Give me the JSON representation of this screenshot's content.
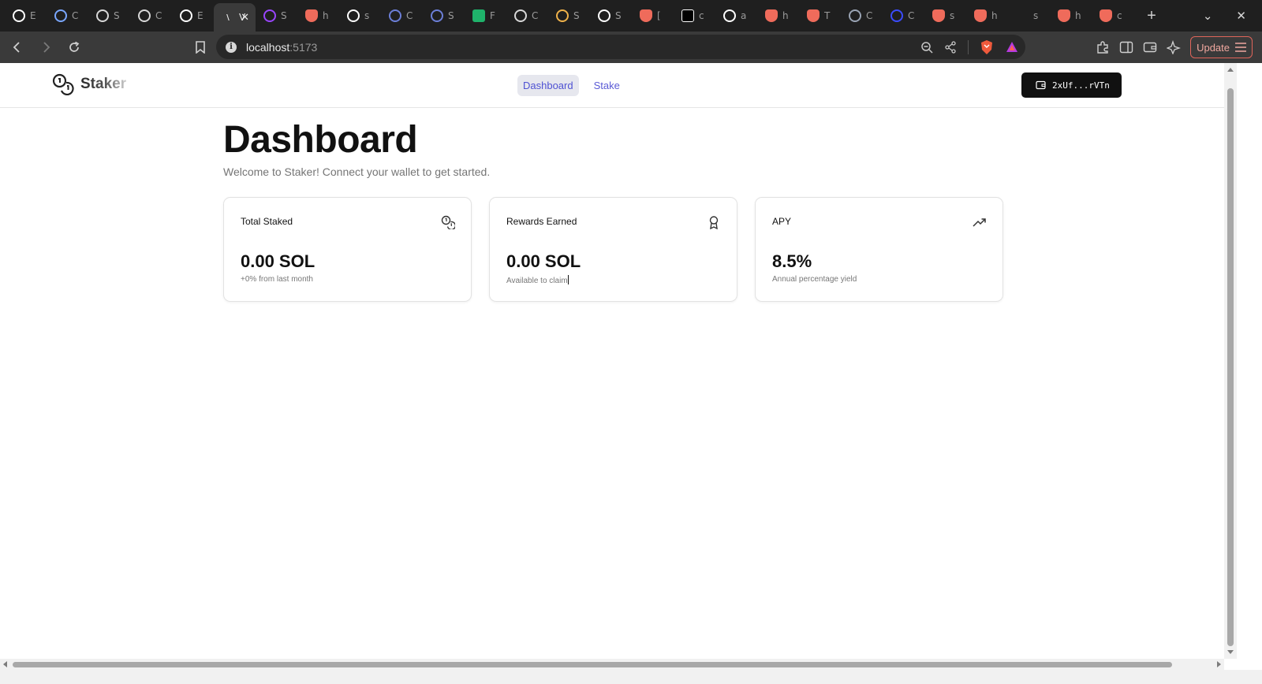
{
  "browser": {
    "tabs": [
      {
        "title": "E",
        "icon": "github-icon",
        "color": "#ffffff"
      },
      {
        "title": "C",
        "icon": "gemini-icon",
        "color": "#7aa7ff"
      },
      {
        "title": "S",
        "icon": "openai-icon",
        "color": "#d8d8d8"
      },
      {
        "title": "C",
        "icon": "globe-icon",
        "color": "#d8d8d8"
      },
      {
        "title": "E",
        "icon": "github-icon",
        "color": "#ffffff"
      },
      {
        "title": "V",
        "icon": "vite-icon",
        "color": "#e8e8e8",
        "active": true
      },
      {
        "title": "S",
        "icon": "solana-icon",
        "color": "#9945ff"
      },
      {
        "title": "h",
        "icon": "brave-icon",
        "color": "#ef6b5b"
      },
      {
        "title": "s",
        "icon": "github-icon",
        "color": "#ffffff"
      },
      {
        "title": "C",
        "icon": "chat-icon",
        "color": "#6c7fd8"
      },
      {
        "title": "S",
        "icon": "chat-icon",
        "color": "#6c7fd8"
      },
      {
        "title": "F",
        "icon": "fork-icon",
        "color": "#1fb36b"
      },
      {
        "title": "C",
        "icon": "clock-icon",
        "color": "#d8d8d8"
      },
      {
        "title": "S",
        "icon": "moon-icon",
        "color": "#f0b24a"
      },
      {
        "title": "S",
        "icon": "pill-icon",
        "color": "#ffffff"
      },
      {
        "title": "[",
        "icon": "brave-icon",
        "color": "#ef6b5b"
      },
      {
        "title": "c",
        "icon": "pen-icon",
        "color": "#ffffff"
      },
      {
        "title": "a",
        "icon": "github-icon",
        "color": "#ffffff"
      },
      {
        "title": "h",
        "icon": "brave-icon",
        "color": "#ef6b5b"
      },
      {
        "title": "T",
        "icon": "brave-icon",
        "color": "#ef6b5b"
      },
      {
        "title": "C",
        "icon": "circle-icon",
        "color": "#9aa4b4"
      },
      {
        "title": "C",
        "icon": "react-icon",
        "color": "#3b4cff"
      },
      {
        "title": "s",
        "icon": "brave-icon",
        "color": "#ef6b5b"
      },
      {
        "title": "h",
        "icon": "brave-icon",
        "color": "#ef6b5b"
      },
      {
        "title": "s",
        "icon": "blank-icon",
        "color": "#1f1f1f"
      },
      {
        "title": "h",
        "icon": "brave-icon",
        "color": "#ef6b5b"
      },
      {
        "title": "c",
        "icon": "brave-icon",
        "color": "#ef6b5b"
      }
    ],
    "url_host": "localhost",
    "url_port": ":5173",
    "update_label": "Update"
  },
  "app": {
    "brand": "Staker",
    "nav": [
      {
        "label": "Dashboard",
        "active": true
      },
      {
        "label": "Stake",
        "active": false
      }
    ],
    "wallet_label": "2xUf...rVTn"
  },
  "page": {
    "title": "Dashboard",
    "subtitle": "Welcome to Staker! Connect your wallet to get started."
  },
  "cards": [
    {
      "title": "Total Staked",
      "value": "0.00 SOL",
      "note": "+0% from last month",
      "icon": "coins-icon"
    },
    {
      "title": "Rewards Earned",
      "value": "0.00 SOL",
      "note": "Available to claim",
      "icon": "award-icon"
    },
    {
      "title": "APY",
      "value": "8.5%",
      "note": "Annual percentage yield",
      "icon": "trending-up-icon"
    }
  ],
  "colors": {
    "accent": "#5b5bd6",
    "nav_active_bg": "#e6e7ee",
    "wallet_bg": "#111111",
    "chrome_dark": "#1f1f1f",
    "chrome_toolbar": "#3a3a3a"
  }
}
